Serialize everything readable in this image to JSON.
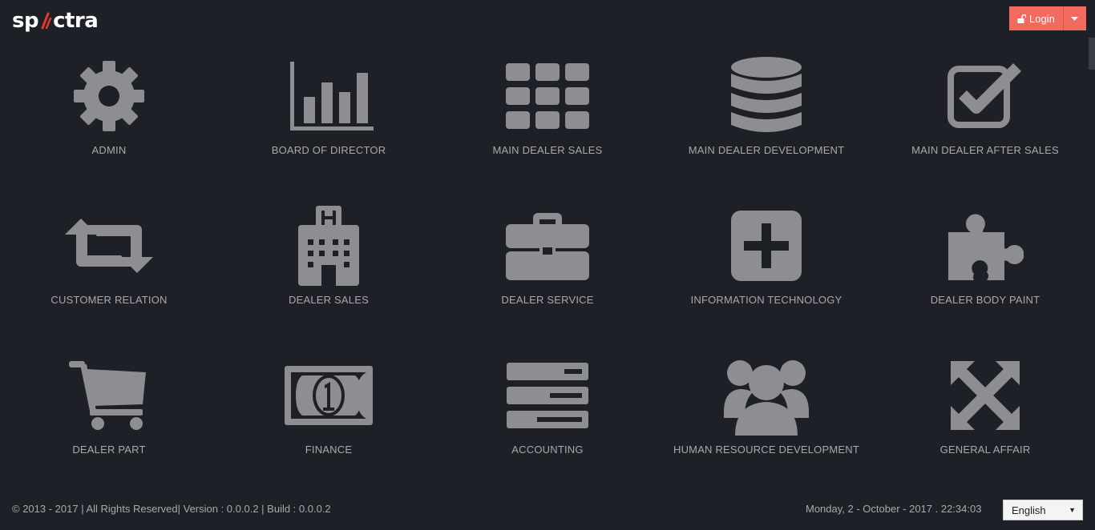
{
  "header": {
    "logo_left": "sp",
    "logo_right": "ctra",
    "login_label": "Login"
  },
  "tiles": [
    {
      "label": "ADMIN",
      "icon": "gear-icon"
    },
    {
      "label": "BOARD OF DIRECTOR",
      "icon": "bar-chart-icon"
    },
    {
      "label": "MAIN DEALER SALES",
      "icon": "grid-icon"
    },
    {
      "label": "MAIN DEALER DEVELOPMENT",
      "icon": "database-icon"
    },
    {
      "label": "MAIN DEALER AFTER SALES",
      "icon": "checkbox-icon"
    },
    {
      "label": "CUSTOMER RELATION",
      "icon": "retweet-icon"
    },
    {
      "label": "DEALER SALES",
      "icon": "hospital-building-icon"
    },
    {
      "label": "DEALER SERVICE",
      "icon": "briefcase-icon"
    },
    {
      "label": "INFORMATION TECHNOLOGY",
      "icon": "plus-square-icon"
    },
    {
      "label": "DEALER BODY PAINT",
      "icon": "puzzle-piece-icon"
    },
    {
      "label": "DEALER PART",
      "icon": "shopping-cart-icon"
    },
    {
      "label": "FINANCE",
      "icon": "money-bill-icon"
    },
    {
      "label": "ACCOUNTING",
      "icon": "server-icon"
    },
    {
      "label": "HUMAN RESOURCE DEVELOPMENT",
      "icon": "users-icon"
    },
    {
      "label": "GENERAL AFFAIR",
      "icon": "expand-arrows-icon"
    }
  ],
  "footer": {
    "copyright": "© 2013 - 2017 | All Rights Reserved| Version : 0.0.0.2 | Build : 0.0.0.2",
    "datetime": "Monday, 2 - October - 2017 . 22:34:03",
    "language": "English"
  },
  "colors": {
    "background": "#1e2027",
    "icon": "#8e8e92",
    "accent": "#f26b5e"
  }
}
